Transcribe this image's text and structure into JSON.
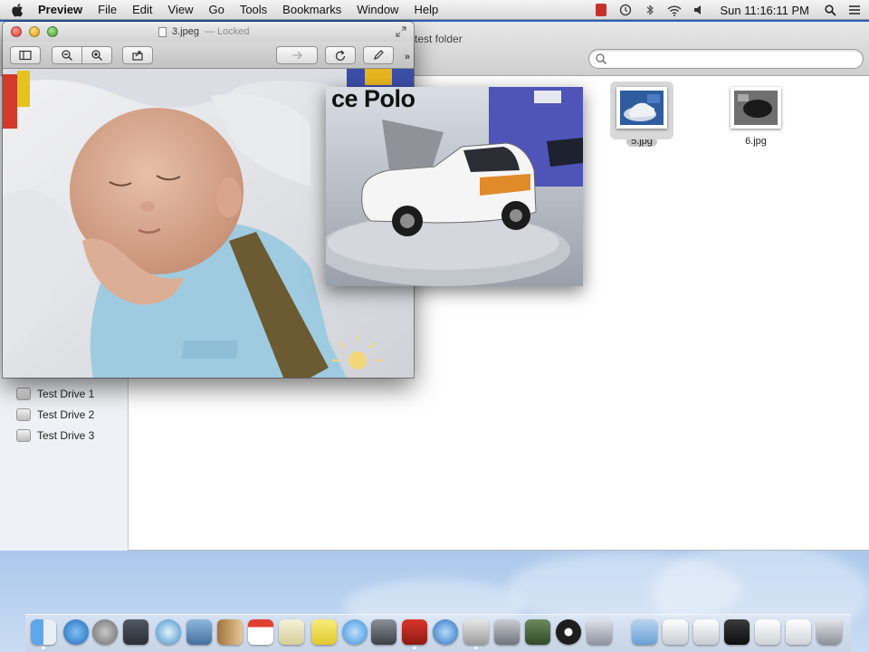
{
  "menubar": {
    "app_name": "Preview",
    "items": [
      "File",
      "Edit",
      "View",
      "Go",
      "Tools",
      "Bookmarks",
      "Window",
      "Help"
    ],
    "clock": "Sun 11:16:11 PM",
    "status_icons": [
      "flag-status-icon",
      "time-machine-icon",
      "bluetooth-icon",
      "wifi-icon",
      "volume-icon"
    ]
  },
  "preview_window": {
    "document_title": "3.jpeg",
    "document_status": "— Locked",
    "toolbar": [
      "sidebar-toggle",
      "zoom-out",
      "zoom-in",
      "share",
      "rotate",
      "annotate"
    ]
  },
  "overlay_photo": {
    "sign_text": "ce Polo"
  },
  "finder": {
    "title": "test folder",
    "search_placeholder": "",
    "sidebar_items": [
      {
        "label": "Test Drive 1"
      },
      {
        "label": "Test Drive 2"
      },
      {
        "label": "Test Drive 3"
      }
    ],
    "files": [
      {
        "name": "5.jpg",
        "selected": true
      },
      {
        "name": "6.jpg",
        "selected": false
      }
    ]
  },
  "dock": {
    "icons": [
      "finder-icon",
      "app-store-icon",
      "launchpad-icon",
      "mission-control-icon",
      "safari-icon",
      "mail-icon",
      "contacts-icon",
      "calendar-icon",
      "notes-icon",
      "reminders-icon",
      "messages-icon",
      "facetime-icon",
      "photo-booth-icon",
      "itunes-icon",
      "preview-icon",
      "system-preferences-icon",
      "terminal-icon",
      "activity-monitor-icon",
      "folder-icon",
      "downloads-icon",
      "trash-icon"
    ],
    "colors": {
      "dock_glass": "#d6deea"
    }
  },
  "colors": {
    "desktop": "#2f66b8",
    "close": "#d6392e",
    "minimize": "#d99a13",
    "zoom": "#3f9b2b"
  }
}
